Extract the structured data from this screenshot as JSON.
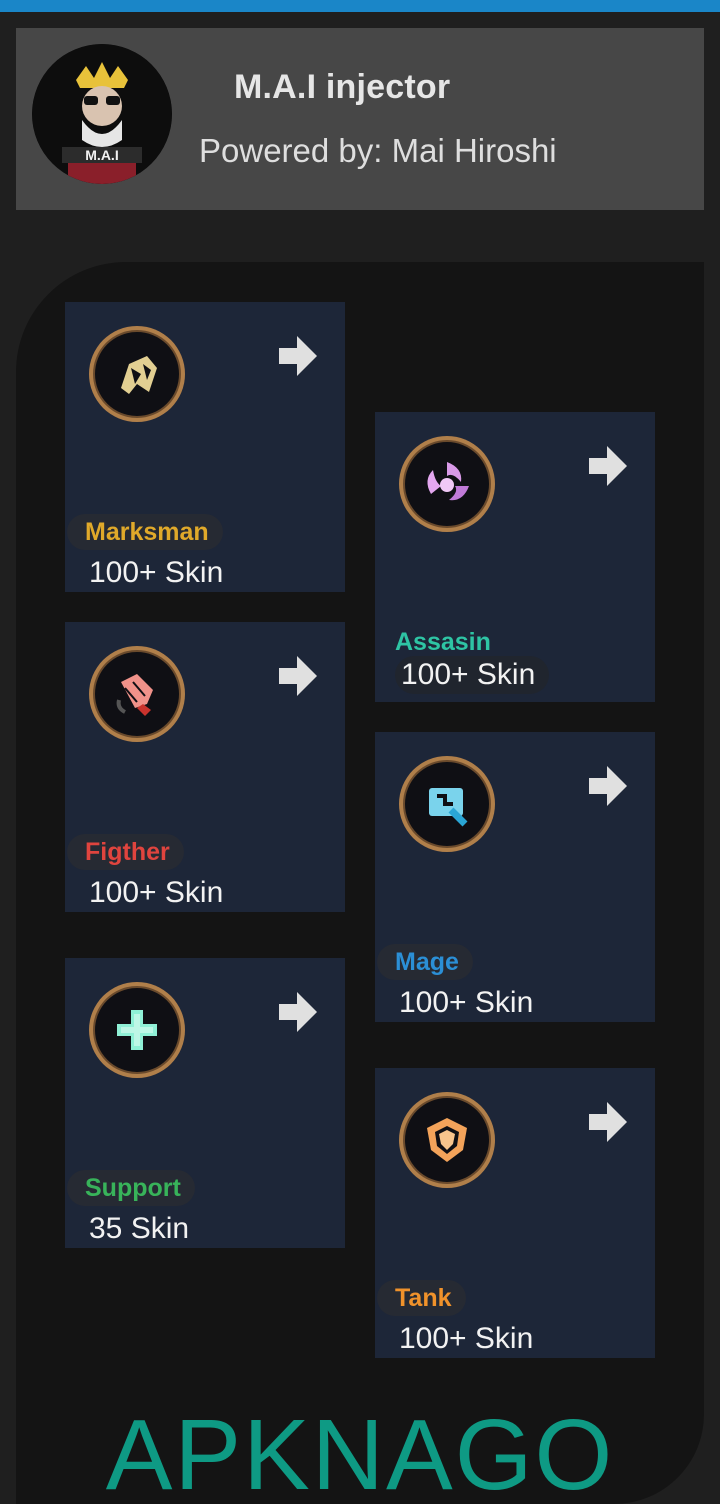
{
  "app": {
    "title": "M.A.I injector",
    "subtitle": "Powered by: Mai Hiroshi",
    "logo_text": "M.A.I"
  },
  "roles": [
    {
      "name": "Marksman",
      "count": "100+ Skin",
      "color": "#e0a92a",
      "icon": "marksman-icon"
    },
    {
      "name": "Assasin",
      "count": "100+ Skin",
      "color": "#2ec4a4",
      "icon": "assassin-icon"
    },
    {
      "name": "Figther",
      "count": "100+ Skin",
      "color": "#e0443e",
      "icon": "fighter-icon"
    },
    {
      "name": "Mage",
      "count": "100+ Skin",
      "color": "#2b8fd6",
      "icon": "mage-icon"
    },
    {
      "name": "Support",
      "count": "35 Skin",
      "color": "#38b35a",
      "icon": "support-icon"
    },
    {
      "name": "Tank",
      "count": "100+ Skin",
      "color": "#f0922b",
      "icon": "tank-icon"
    }
  ],
  "watermark": "APKNAGO",
  "colors": {
    "accent_bar": "#1a86c8",
    "card_bg": "#1d2638",
    "header_bg": "#474747"
  }
}
